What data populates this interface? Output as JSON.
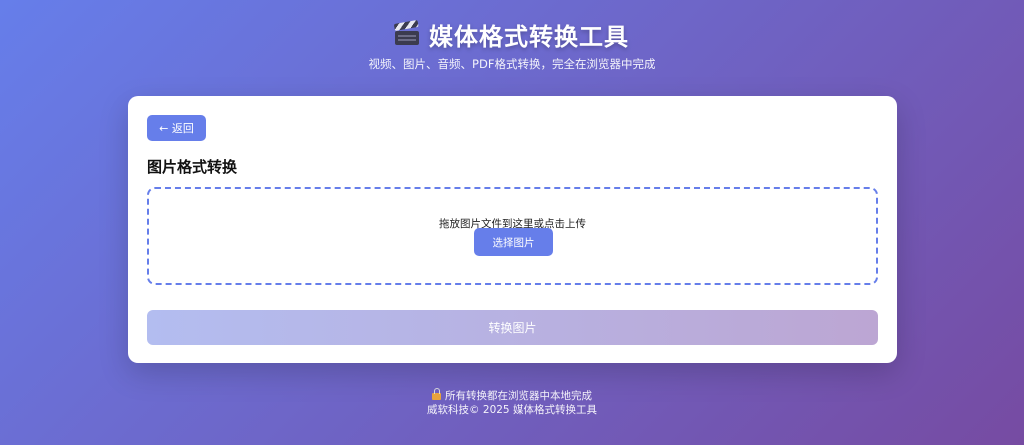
{
  "header": {
    "icon": "clapperboard-icon",
    "title": "媒体格式转换工具",
    "subtitle": "视频、图片、音频、PDF格式转换，完全在浏览器中完成"
  },
  "card": {
    "back_label": "← 返回",
    "section_title": "图片格式转换",
    "dropzone_text": "拖放图片文件到这里或点击上传",
    "select_label": "选择图片",
    "convert_label": "转换图片"
  },
  "footer": {
    "icon": "lock-icon",
    "local_note": "所有转换都在浏览器中本地完成",
    "copyright": "威软科技© 2025 媒体格式转换工具"
  },
  "colors": {
    "accent": "#667eea",
    "gradient_start": "#667eea",
    "gradient_end": "#764ba2"
  }
}
